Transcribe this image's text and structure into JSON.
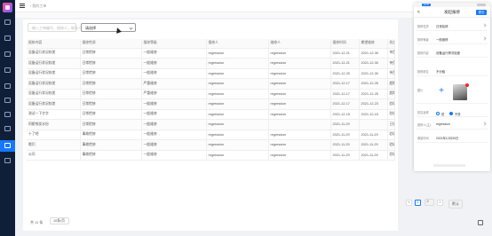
{
  "app": {
    "breadcrumb": "/ 我的工单"
  },
  "filters": {
    "search_placeholder": "输入工单编号、报修人、联系人",
    "status_value": "请选择"
  },
  "table": {
    "columns": [
      "报修内容",
      "报修性质",
      "报修等级",
      "报修人",
      "维修人",
      "报修时间",
      "期望维修",
      "状态"
    ],
    "rows": [
      [
        "设备运行状况较差",
        "日常检修",
        "一般维修",
        "regression",
        "regression",
        "2021-12-21",
        "2021-12-30",
        "待受理"
      ],
      [
        "设备运行状况较差",
        "日常检修",
        "一般维修",
        "regression",
        "regression",
        "2021-12-21",
        "2021-12-30",
        "待受理"
      ],
      [
        "设备运行状况较差",
        "日常检修",
        "一般维修",
        "regression",
        "regression",
        "2021-12-20",
        "2021-12-30",
        "待受理"
      ],
      [
        "设备运行状况较差",
        "日常检修",
        "严重维修",
        "regression",
        "regression",
        "2021-12-17",
        "2021-12-25",
        "超期待受理"
      ],
      [
        "设备运行状况较差",
        "日常检修",
        "严重维修",
        "regression",
        "regression",
        "2021-12-17",
        "2021-12-25",
        "超期待受理"
      ],
      [
        "设备运行状况较差",
        "日常检修",
        "一般维修",
        "regression",
        "regression",
        "2021-12-17",
        "2021-12-23",
        "验收通过"
      ],
      [
        "测试一下字字",
        "日常检修",
        "一般维修",
        "regression",
        "regression",
        "2021-12-15",
        "2021-12-15",
        "验收通过"
      ],
      [
        "阿斯顿发水份",
        "日常检修",
        "一般维修",
        "regression",
        "",
        "2021-11-29",
        "",
        "已驳回"
      ],
      [
        "十了吧",
        "事故检修",
        "一般维修",
        "regression",
        "regression",
        "2021-11-29",
        "2021-11-29",
        "验收不通过"
      ],
      [
        "哦们",
        "事故检修",
        "一般维修",
        "regression",
        "regression",
        "2021-11-29",
        "2021-11-29",
        "验收不通过"
      ],
      [
        "公司",
        "事故检修",
        "一般维修",
        "regression",
        "regression",
        "2021-11-29",
        "2021-11-29",
        "验收不通过"
      ]
    ]
  },
  "pager": {
    "total": "共 11 条",
    "page_size": "10条/页",
    "prev": "<",
    "pages": [
      "1",
      "2"
    ],
    "next": ">",
    "size_label": "默认"
  },
  "drawer": {
    "status_time": "10:30",
    "back": "<",
    "title": "发起报修",
    "submit": "提交",
    "fields": [
      {
        "label": "报修性质",
        "value": "日常检修"
      },
      {
        "label": "报修等级",
        "value": "一般维修"
      },
      {
        "label": "报修内容",
        "value": "设备运行情况较差"
      },
      {
        "label": "报修部位",
        "value": "不分租"
      },
      {
        "label": "图片",
        "value": ""
      },
      {
        "label": "是否返修",
        "value": ""
      },
      {
        "label": "报修人(主)",
        "value": "regression"
      },
      {
        "label": "期望时间",
        "value": "2021年12月30日"
      }
    ],
    "upload_plus": "+",
    "radio_yes": "是",
    "radio_no": "不是"
  }
}
